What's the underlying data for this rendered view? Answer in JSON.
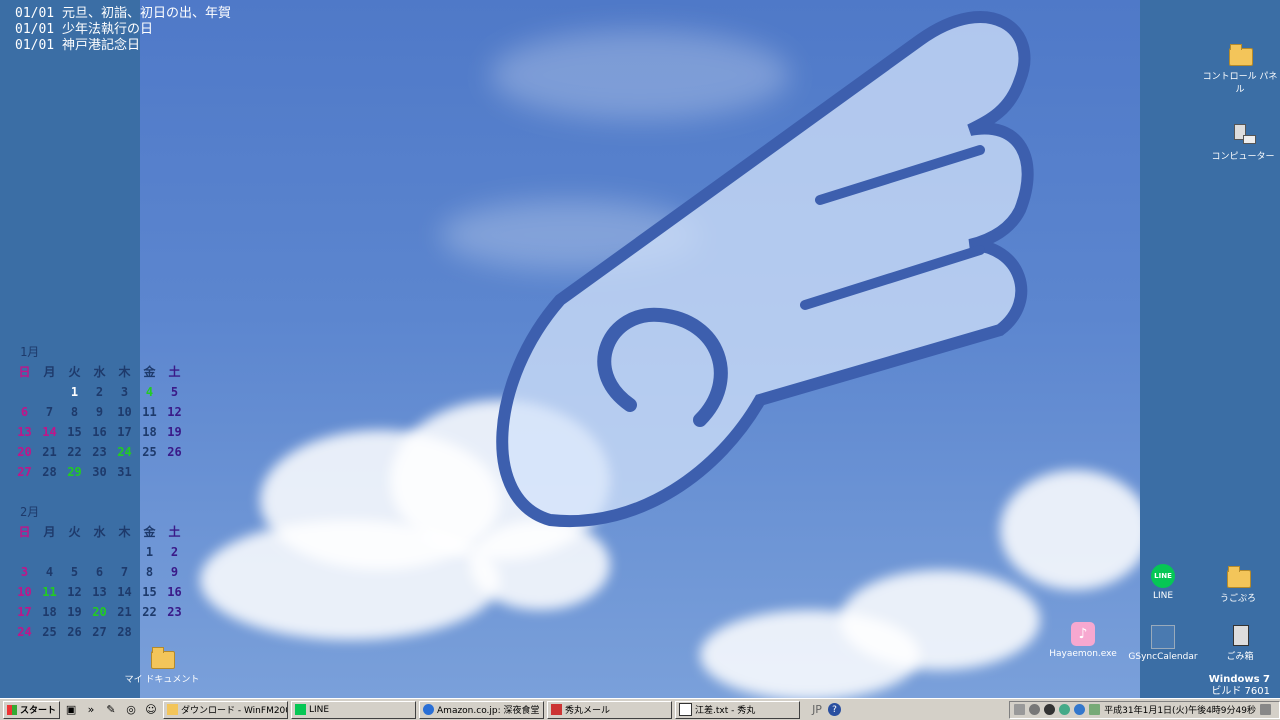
{
  "events": [
    "01/01 元旦、初詣、初日の出、年賀",
    "01/01 少年法執行の日",
    "01/01 神戸港記念日"
  ],
  "calendar": [
    {
      "month_label": "1月",
      "weekdays": [
        "日",
        "月",
        "火",
        "水",
        "木",
        "金",
        "土"
      ],
      "weeks": [
        [
          "",
          "",
          "",
          "1",
          "2",
          "3",
          "4",
          "5"
        ],
        [
          "6",
          "7",
          "8",
          "9",
          "10",
          "11",
          "12"
        ],
        [
          "13",
          "14",
          "15",
          "16",
          "17",
          "18",
          "19"
        ],
        [
          "20",
          "21",
          "22",
          "23",
          "24",
          "25",
          "26"
        ],
        [
          "27",
          "28",
          "29",
          "30",
          "31",
          "",
          ""
        ]
      ]
    },
    {
      "month_label": "2月",
      "weekdays": [
        "日",
        "月",
        "火",
        "水",
        "木",
        "金",
        "土"
      ],
      "weeks": [
        [
          "",
          "",
          "",
          "",
          "",
          "1",
          "2"
        ],
        [
          "3",
          "4",
          "5",
          "6",
          "7",
          "8",
          "9"
        ],
        [
          "10",
          "11",
          "12",
          "13",
          "14",
          "15",
          "16"
        ],
        [
          "17",
          "18",
          "19",
          "20",
          "21",
          "22",
          "23"
        ],
        [
          "24",
          "25",
          "26",
          "27",
          "28",
          "",
          ""
        ]
      ]
    }
  ],
  "desktop_icons": {
    "control_panel": "コントロール パネル",
    "computer": "コンピューター",
    "line": "LINE",
    "ubuntu": "うごぷろ",
    "hayaemon": "Hayaemon.exe",
    "gsync": "GSyncCalendar",
    "trash": "ごみ箱",
    "my_documents": "マイ ドキュメント"
  },
  "version": {
    "os": "Windows 7",
    "build": "ビルド 7601"
  },
  "taskbar": {
    "start": "スタート",
    "tasks": [
      "ダウンロード - WinFM200...",
      "LINE",
      "Amazon.co.jp: 深夜食堂 ...",
      "秀丸メール",
      "江差.txt - 秀丸"
    ],
    "ime": "JP",
    "clock": "平成31年1月1日(火)午後4時9分49秒"
  },
  "colors": {
    "desktop": "#3b6ea5",
    "sunday": "#c0158a",
    "saturday": "#3a1a88",
    "holiday": "#22cc22"
  }
}
